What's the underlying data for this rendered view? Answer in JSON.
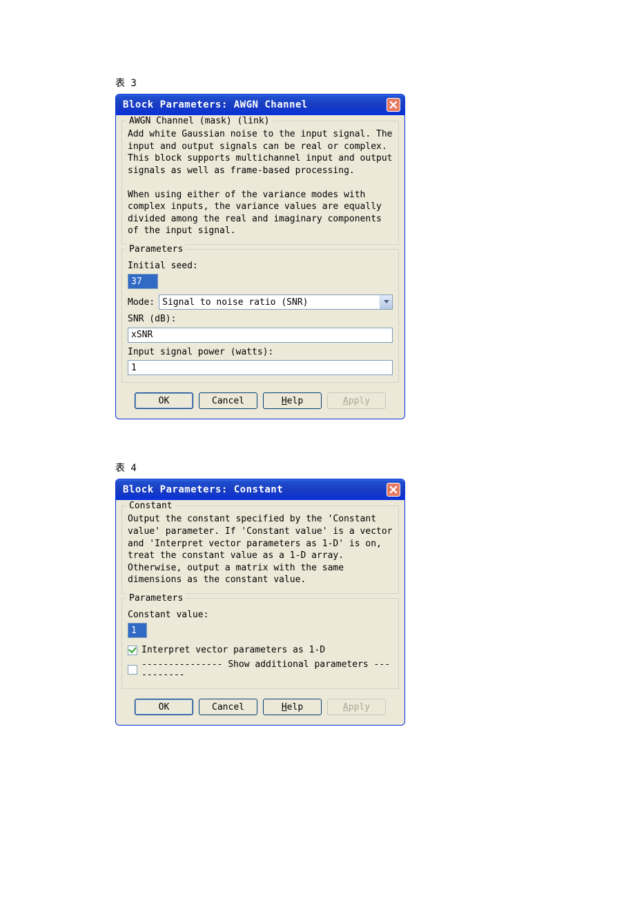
{
  "captions": {
    "t3": "表 3",
    "t4": "表 4"
  },
  "dialog1": {
    "title": "Block Parameters: AWGN Channel",
    "legend_top": "AWGN Channel (mask) (link)",
    "desc": "Add white Gaussian noise to the input signal. The input and output signals can be real or complex. This block supports multichannel input and output signals as well as frame-based processing.\n\nWhen using either of the variance modes with complex inputs, the variance values are equally divided among the real and imaginary components of the input signal.",
    "legend_params": "Parameters",
    "labels": {
      "initial_seed": "Initial seed:",
      "mode": "Mode:",
      "snr_db": "SNR (dB):",
      "input_power": "Input signal power (watts):"
    },
    "values": {
      "initial_seed": "37",
      "mode_selected": "Signal to noise ratio  (SNR)",
      "snr_db": "xSNR",
      "input_power": "1"
    }
  },
  "dialog2": {
    "title": "Block Parameters: Constant",
    "legend_top": "Constant",
    "desc": "Output the constant specified by the 'Constant value' parameter. If 'Constant value' is a vector and 'Interpret vector parameters as 1-D' is on, treat the constant value as a 1-D array. Otherwise, output a matrix with the same dimensions as the constant value.",
    "legend_params": "Parameters",
    "labels": {
      "constant_value": "Constant value:",
      "interpret_1d": "Interpret vector parameters as 1-D",
      "show_additional": "--------------- Show additional parameters -----------"
    },
    "values": {
      "constant_value": "1",
      "interpret_checked": true,
      "show_additional_checked": false
    }
  },
  "buttons": {
    "ok": "OK",
    "cancel": "Cancel",
    "help_pre": "H",
    "help_post": "elp",
    "apply_pre": "A",
    "apply_post": "pply"
  }
}
